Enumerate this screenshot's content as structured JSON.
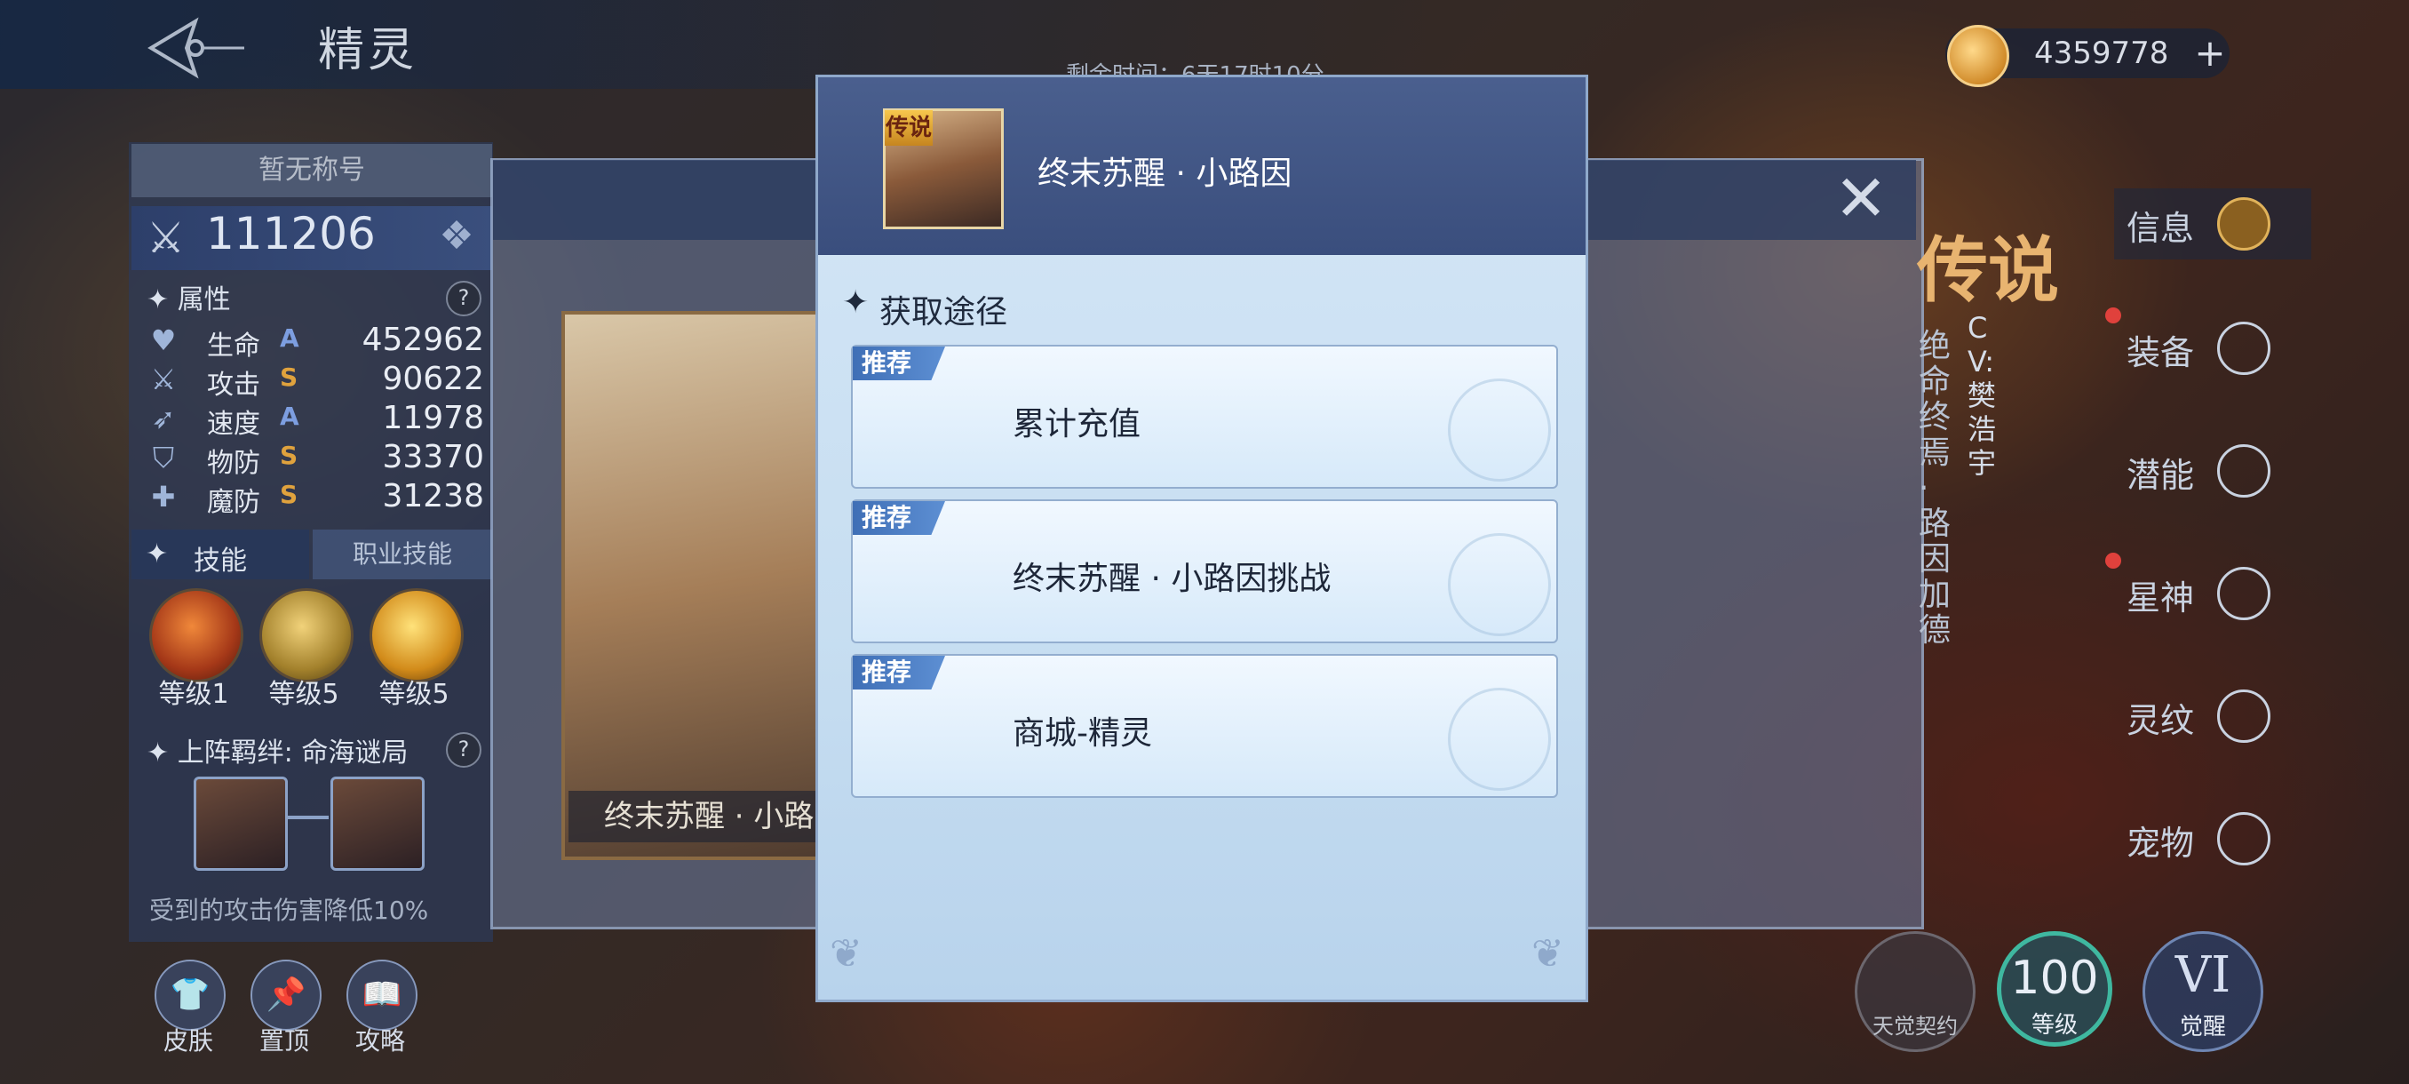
{
  "app": {
    "title": "精灵",
    "timer": "剩余时间：6天17时10分"
  },
  "currency": {
    "icon": "coin-icon",
    "value": "4359778",
    "add": "+"
  },
  "left_panel": {
    "title_badge": "暂无称号",
    "power": "111206",
    "attributes": {
      "header": "属性",
      "help": "?",
      "stats": [
        {
          "icon": "heart-icon",
          "name": "生命",
          "grade": "A",
          "value": "452962",
          "grade_color": "#7d9ee0"
        },
        {
          "icon": "sword-icon",
          "name": "攻击",
          "grade": "S",
          "value": "90622",
          "grade_color": "#e0a23d"
        },
        {
          "icon": "speed-icon",
          "name": "速度",
          "grade": "A",
          "value": "11978",
          "grade_color": "#7d9ee0"
        },
        {
          "icon": "shield-icon",
          "name": "物防",
          "grade": "S",
          "value": "33370",
          "grade_color": "#e0a23d"
        },
        {
          "icon": "magic-shield-icon",
          "name": "魔防",
          "grade": "S",
          "value": "31238",
          "grade_color": "#e0a23d"
        }
      ]
    },
    "skills": {
      "tab_skills": "技能",
      "tab_class": "职业技能",
      "levels": [
        "等级1",
        "等级5",
        "等级5"
      ]
    },
    "bond": {
      "header": "上阵羁绊: 命海谜局",
      "help": "?",
      "desc": "受到的攻击伤害降低10%"
    },
    "bottom_buttons": [
      {
        "icon": "skin-icon",
        "label": "皮肤"
      },
      {
        "icon": "pin-icon",
        "label": "置顶"
      },
      {
        "icon": "guide-icon",
        "label": "攻略"
      }
    ]
  },
  "hero_card": {
    "name": "终末苏醒 · 小路因"
  },
  "right_side": {
    "rarity": "传说",
    "epithet": "绝命终焉 · 路因加德",
    "cv": "CV: 樊浩宇",
    "nav": [
      {
        "label": "信息",
        "icon": "info-icon"
      },
      {
        "label": "装备",
        "icon": "equipment-icon"
      },
      {
        "label": "潜能",
        "icon": "potential-icon"
      },
      {
        "label": "星神",
        "icon": "star-god-icon"
      },
      {
        "label": "灵纹",
        "icon": "rune-icon"
      },
      {
        "label": "宠物",
        "icon": "pet-icon"
      }
    ],
    "awaken_contract": "天觉契约",
    "level_value": "100",
    "level_label": "等级",
    "awaken_value": "VI",
    "awaken_label": "觉醒"
  },
  "modal": {
    "avatar_tag": "传说",
    "title": "终末苏醒 · 小路因",
    "section_title": "获取途径",
    "routes": [
      {
        "tag": "推荐",
        "name": "累计充值"
      },
      {
        "tag": "推荐",
        "name": "终末苏醒 · 小路因挑战"
      },
      {
        "tag": "推荐",
        "name": "商城-精灵"
      }
    ]
  }
}
